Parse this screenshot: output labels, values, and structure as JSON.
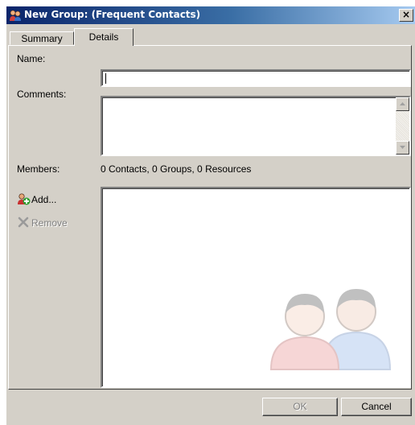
{
  "window": {
    "title": "New Group:  (Frequent Contacts)",
    "close_glyph": "×"
  },
  "tabs": [
    {
      "label": "Summary",
      "selected": false
    },
    {
      "label": "Details",
      "selected": true
    }
  ],
  "form": {
    "name_label": "Name:",
    "name_value": "",
    "comments_label": "Comments:",
    "comments_value": "",
    "members_label": "Members:",
    "members_summary": "0 Contacts, 0 Groups, 0 Resources"
  },
  "member_actions": {
    "add_label": "Add...",
    "remove_label": "Remove"
  },
  "buttons": {
    "ok_label": "OK",
    "cancel_label": "Cancel"
  },
  "icons": {
    "title": "group-icon",
    "add": "add-member-icon",
    "remove": "remove-x-icon",
    "watermark": "people-watermark-icon"
  }
}
